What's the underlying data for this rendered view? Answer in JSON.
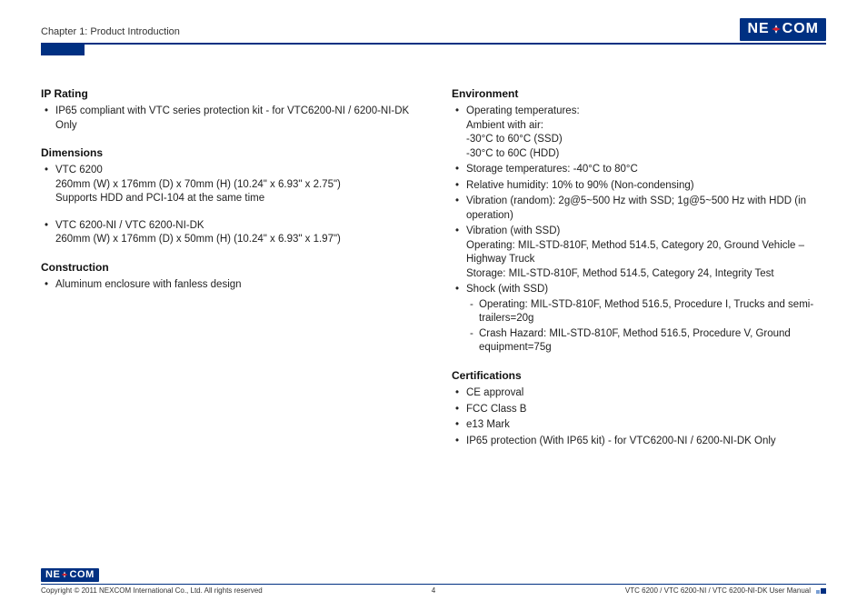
{
  "header": {
    "chapter": "Chapter 1: Product Introduction",
    "logo": {
      "pre": "NE",
      "post": "COM"
    }
  },
  "left": {
    "ip_rating": {
      "title": "IP Rating",
      "items": [
        "IP65 compliant with VTC series protection kit - for VTC6200-NI / 6200-NI-DK Only"
      ]
    },
    "dimensions": {
      "title": "Dimensions",
      "items": [
        {
          "line1": "VTC 6200",
          "line2": "260mm (W) x 176mm (D) x 70mm (H) (10.24\" x 6.93\" x 2.75\")",
          "line3": "Supports HDD and PCI-104 at the same time"
        },
        {
          "line1": "VTC 6200-NI / VTC 6200-NI-DK",
          "line2": "260mm (W) x 176mm (D) x 50mm (H) (10.24\" x 6.93\" x 1.97\")"
        }
      ]
    },
    "construction": {
      "title": "Construction",
      "items": [
        "Aluminum enclosure with fanless design"
      ]
    }
  },
  "right": {
    "environment": {
      "title": "Environment",
      "items": {
        "op_temp": {
          "l1": "Operating temperatures:",
          "l2": "Ambient with air:",
          "l3": "-30°C to 60°C (SSD)",
          "l4": "-30°C to 60C (HDD)"
        },
        "storage_temp": "Storage temperatures: -40°C to 80°C",
        "humidity": "Relative humidity: 10% to 90% (Non-condensing)",
        "vib_random": "Vibration (random): 2g@5~500 Hz with SSD; 1g@5~500 Hz with HDD (in operation)",
        "vib_ssd": {
          "l1": "Vibration (with SSD)",
          "l2": "Operating: MIL-STD-810F, Method 514.5, Category 20, Ground Vehicle – Highway Truck",
          "l3": "Storage: MIL-STD-810F, Method 514.5, Category 24, Integrity Test"
        },
        "shock": {
          "l1": "Shock (with SSD)",
          "d1": "Operating: MIL-STD-810F, Method 516.5, Procedure I, Trucks and semi-trailers=20g",
          "d2": "Crash Hazard: MIL-STD-810F, Method 516.5, Procedure V, Ground equipment=75g"
        }
      }
    },
    "certifications": {
      "title": "Certifications",
      "items": [
        "CE approval",
        "FCC Class B",
        "e13 Mark",
        "IP65 protection (With IP65 kit) - for VTC6200-NI / 6200-NI-DK Only"
      ]
    }
  },
  "footer": {
    "copyright": "Copyright © 2011 NEXCOM International Co., Ltd. All rights reserved",
    "page_number": "4",
    "doc_title": "VTC 6200 / VTC 6200-NI / VTC 6200-NI-DK User Manual"
  }
}
